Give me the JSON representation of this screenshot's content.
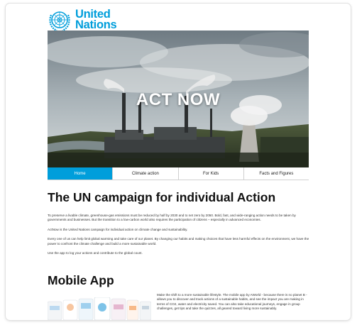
{
  "brand": {
    "line1": "United",
    "line2": "Nations"
  },
  "hero": {
    "title": "ACT NOW"
  },
  "nav": [
    {
      "label": "Home",
      "active": true
    },
    {
      "label": "Climate action",
      "active": false
    },
    {
      "label": "For Kids",
      "active": false
    },
    {
      "label": "Facts and Figures",
      "active": false
    }
  ],
  "main": {
    "title": "The UN campaign for individual Action",
    "paragraphs": [
      "To preserve a livable climate, greenhouse-gas emissions must be reduced by half by 2030 and to net zero by 2050. Bold, fast, and wide-ranging action needs to be taken by governments and businesses. But the transition to a low-carbon world also requires the participation of citizens – especially in advanced economies.",
      "ActNow is the United Nations campaign for individual action on climate change and sustainability.",
      "Every one of us can help limit global warming and take care of our planet. By changing our habits and making choices that have less harmful effects on the environment, we have the power to confront the climate challenge and build a more sustainable world.",
      "Use the app to log your actions and contribute to the global count."
    ]
  },
  "mobile": {
    "title": "Mobile App",
    "text": "Make the shift to a more sustainable lifestyle. The mobile app by AWorld - because there is no planet B - allows you to discover and track actions of a sustainable habits, and see the impact you are making in terms of CO2, water and electricity saved. You can also take educational journeys, engage in group challenges, get tips and take the quizzes, all geared toward living more sustainably."
  },
  "colors": {
    "accent": "#009edb",
    "text": "#111111"
  }
}
